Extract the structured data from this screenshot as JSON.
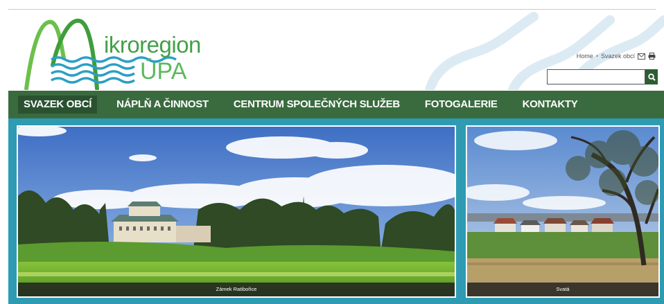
{
  "logo": {
    "word_1": "ikroregion",
    "word_2": "ÚPA"
  },
  "breadcrumb": {
    "home": "Home",
    "separator": "•",
    "current": "Svazek obcí",
    "icons": [
      "mail-icon",
      "print-icon"
    ]
  },
  "search": {
    "value": "",
    "placeholder": "",
    "button_icon": "search-icon"
  },
  "nav": {
    "items": [
      {
        "label": "SVAZEK OBCÍ",
        "active": true
      },
      {
        "label": "NÁPLŇ A ČINNOST",
        "active": false
      },
      {
        "label": "CENTRUM SPOLEČNÝCH SLUŽEB",
        "active": false
      },
      {
        "label": "FOTOGALERIE",
        "active": false
      },
      {
        "label": "KONTAKTY",
        "active": false
      }
    ]
  },
  "gallery": {
    "photos": [
      {
        "caption": "Zámek Ratibořice"
      },
      {
        "caption": "Svatá"
      }
    ]
  },
  "colors": {
    "nav_bg": "#3a6b3e",
    "nav_active_bg": "#2b5230",
    "band_bg": "#2e9bb3",
    "logo_green": "#43a047"
  }
}
